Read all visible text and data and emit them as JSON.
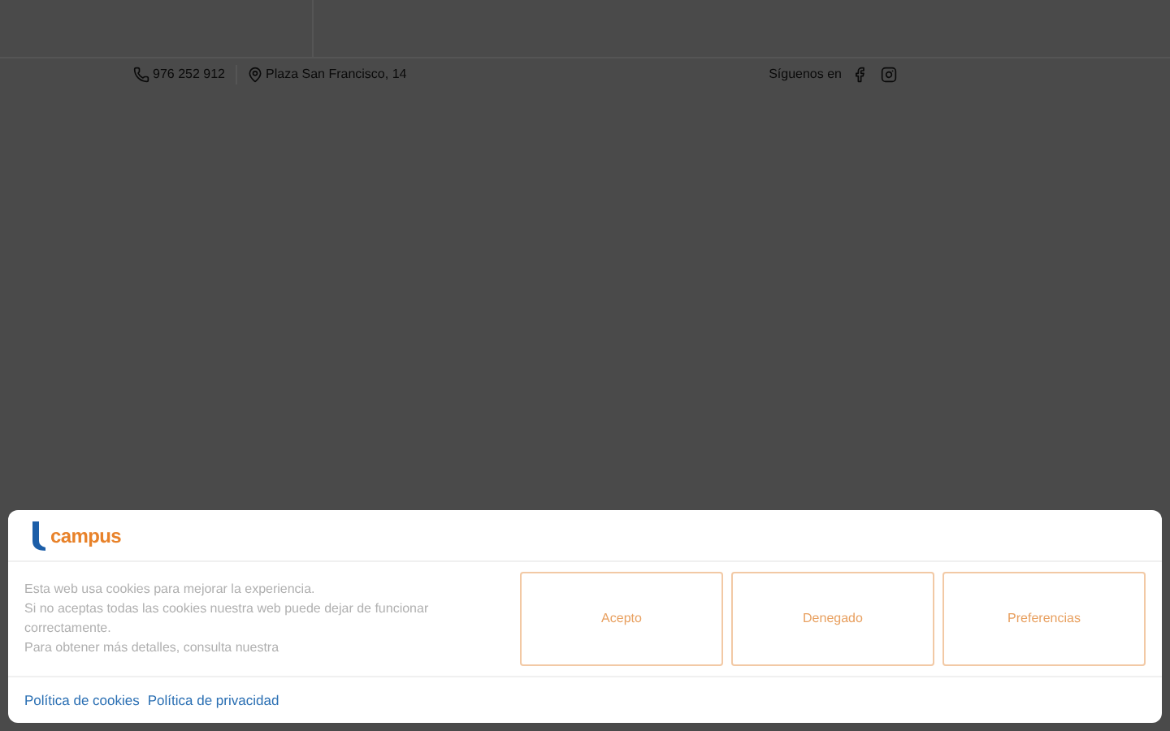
{
  "topbar": {
    "phone": "976 252 912",
    "address": "Plaza San Francisco, 14",
    "follow_label": "Síguenos en"
  },
  "cookie_banner": {
    "logo": "campus",
    "lines": [
      "Esta web usa cookies para mejorar la experiencia.",
      "Si no aceptas todas las cookies nuestra web puede dejar de funcionar correctamente.",
      "Para obtener más detalles, consulta nuestra"
    ],
    "buttons": [
      "Acepto",
      "Denegado",
      "Preferencias"
    ],
    "links": [
      "Política de cookies",
      "Política de privacidad"
    ]
  }
}
